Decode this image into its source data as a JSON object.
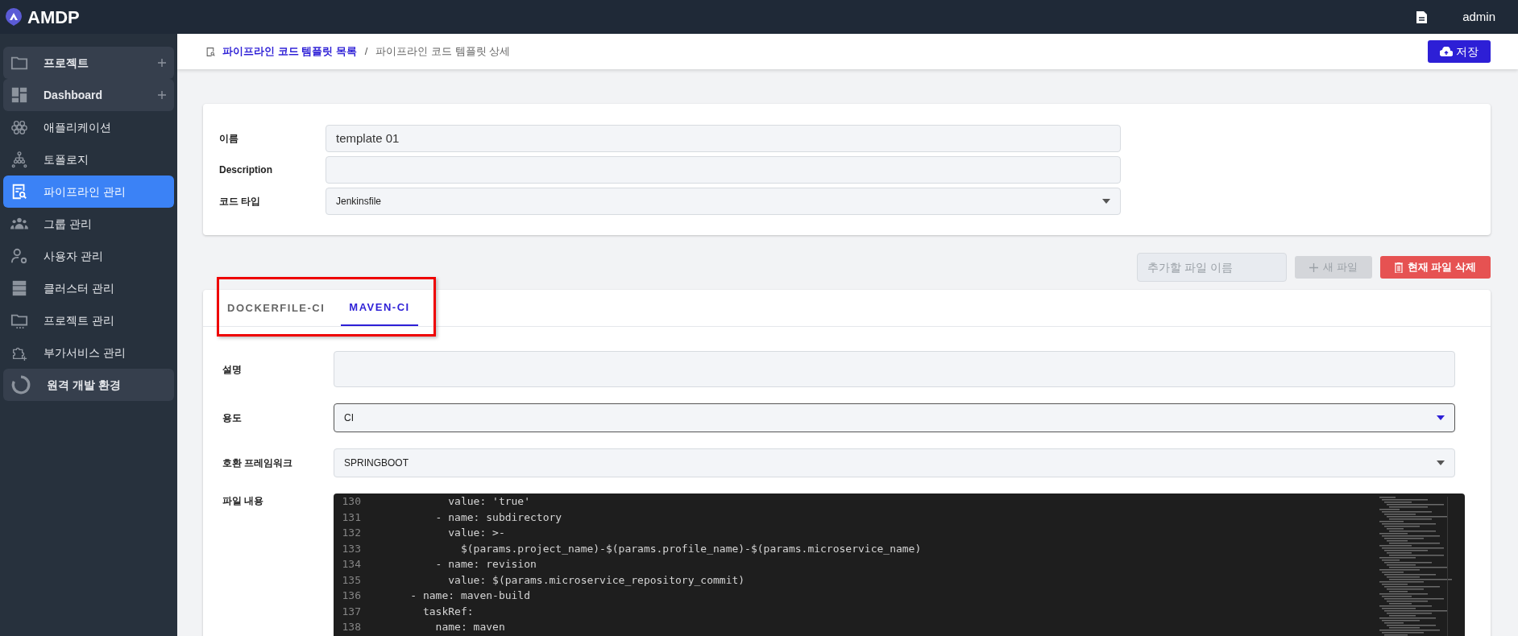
{
  "header": {
    "logo": "AMDP",
    "user": "admin"
  },
  "sidebar": {
    "items": [
      {
        "label": "프로젝트",
        "kind": "group",
        "selected": false
      },
      {
        "label": "Dashboard",
        "kind": "group",
        "selected": false
      },
      {
        "label": "애플리케이션",
        "kind": "link",
        "selected": false
      },
      {
        "label": "토폴로지",
        "kind": "link",
        "selected": false
      },
      {
        "label": "파이프라인 관리",
        "kind": "link",
        "selected": true
      },
      {
        "label": "그룹 관리",
        "kind": "link",
        "selected": false
      },
      {
        "label": "사용자 관리",
        "kind": "link",
        "selected": false
      },
      {
        "label": "클러스터 관리",
        "kind": "link",
        "selected": false
      },
      {
        "label": "프로젝트 관리",
        "kind": "link",
        "selected": false
      },
      {
        "label": "부가서비스 관리",
        "kind": "link",
        "selected": false
      },
      {
        "label": "원격 개발 환경",
        "kind": "panel",
        "selected": false
      }
    ]
  },
  "breadcrumb": {
    "link": "파이프라인 코드 템플릿 목록",
    "separator": "/",
    "current": "파이프라인 코드 템플릿 상세"
  },
  "save_button": "저장",
  "template_form": [
    {
      "label": "이름",
      "kind": "text",
      "value": "template 01"
    },
    {
      "label": "Description",
      "kind": "text"
    },
    {
      "label": "코드 타입",
      "kind": "select",
      "value": "Jenkinsfile",
      "focused": false
    }
  ],
  "file_actions": {
    "placeholder": "추가할 파일 이름",
    "new_file": "새 파일",
    "new_file_disabled": true,
    "delete": "현재 파일 삭제"
  },
  "tabs": [
    {
      "label": "DOCKERFILE-CI",
      "selected": false
    },
    {
      "label": "MAVEN-CI",
      "selected": true
    }
  ],
  "file_form": [
    {
      "label": "설명",
      "kind": "textarea"
    },
    {
      "label": "용도",
      "kind": "select",
      "value": "CI",
      "focused": true
    },
    {
      "label": "호환 프레임워크",
      "kind": "select",
      "value": "SPRINGBOOT",
      "focused": false
    }
  ],
  "editor": {
    "label": "파일 내용",
    "lines": [
      {
        "number": "130",
        "text": "          value: 'true'"
      },
      {
        "number": "131",
        "text": "        - name: subdirectory"
      },
      {
        "number": "132",
        "text": "          value: >-"
      },
      {
        "number": "133",
        "text": "            $(params.project_name)-$(params.profile_name)-$(params.microservice_name)"
      },
      {
        "number": "134",
        "text": "        - name: revision"
      },
      {
        "number": "135",
        "text": "          value: $(params.microservice_repository_commit)"
      },
      {
        "number": "136",
        "text": "    - name: maven-build"
      },
      {
        "number": "137",
        "text": "      taskRef:"
      },
      {
        "number": "138",
        "text": "        name: maven"
      }
    ]
  }
}
